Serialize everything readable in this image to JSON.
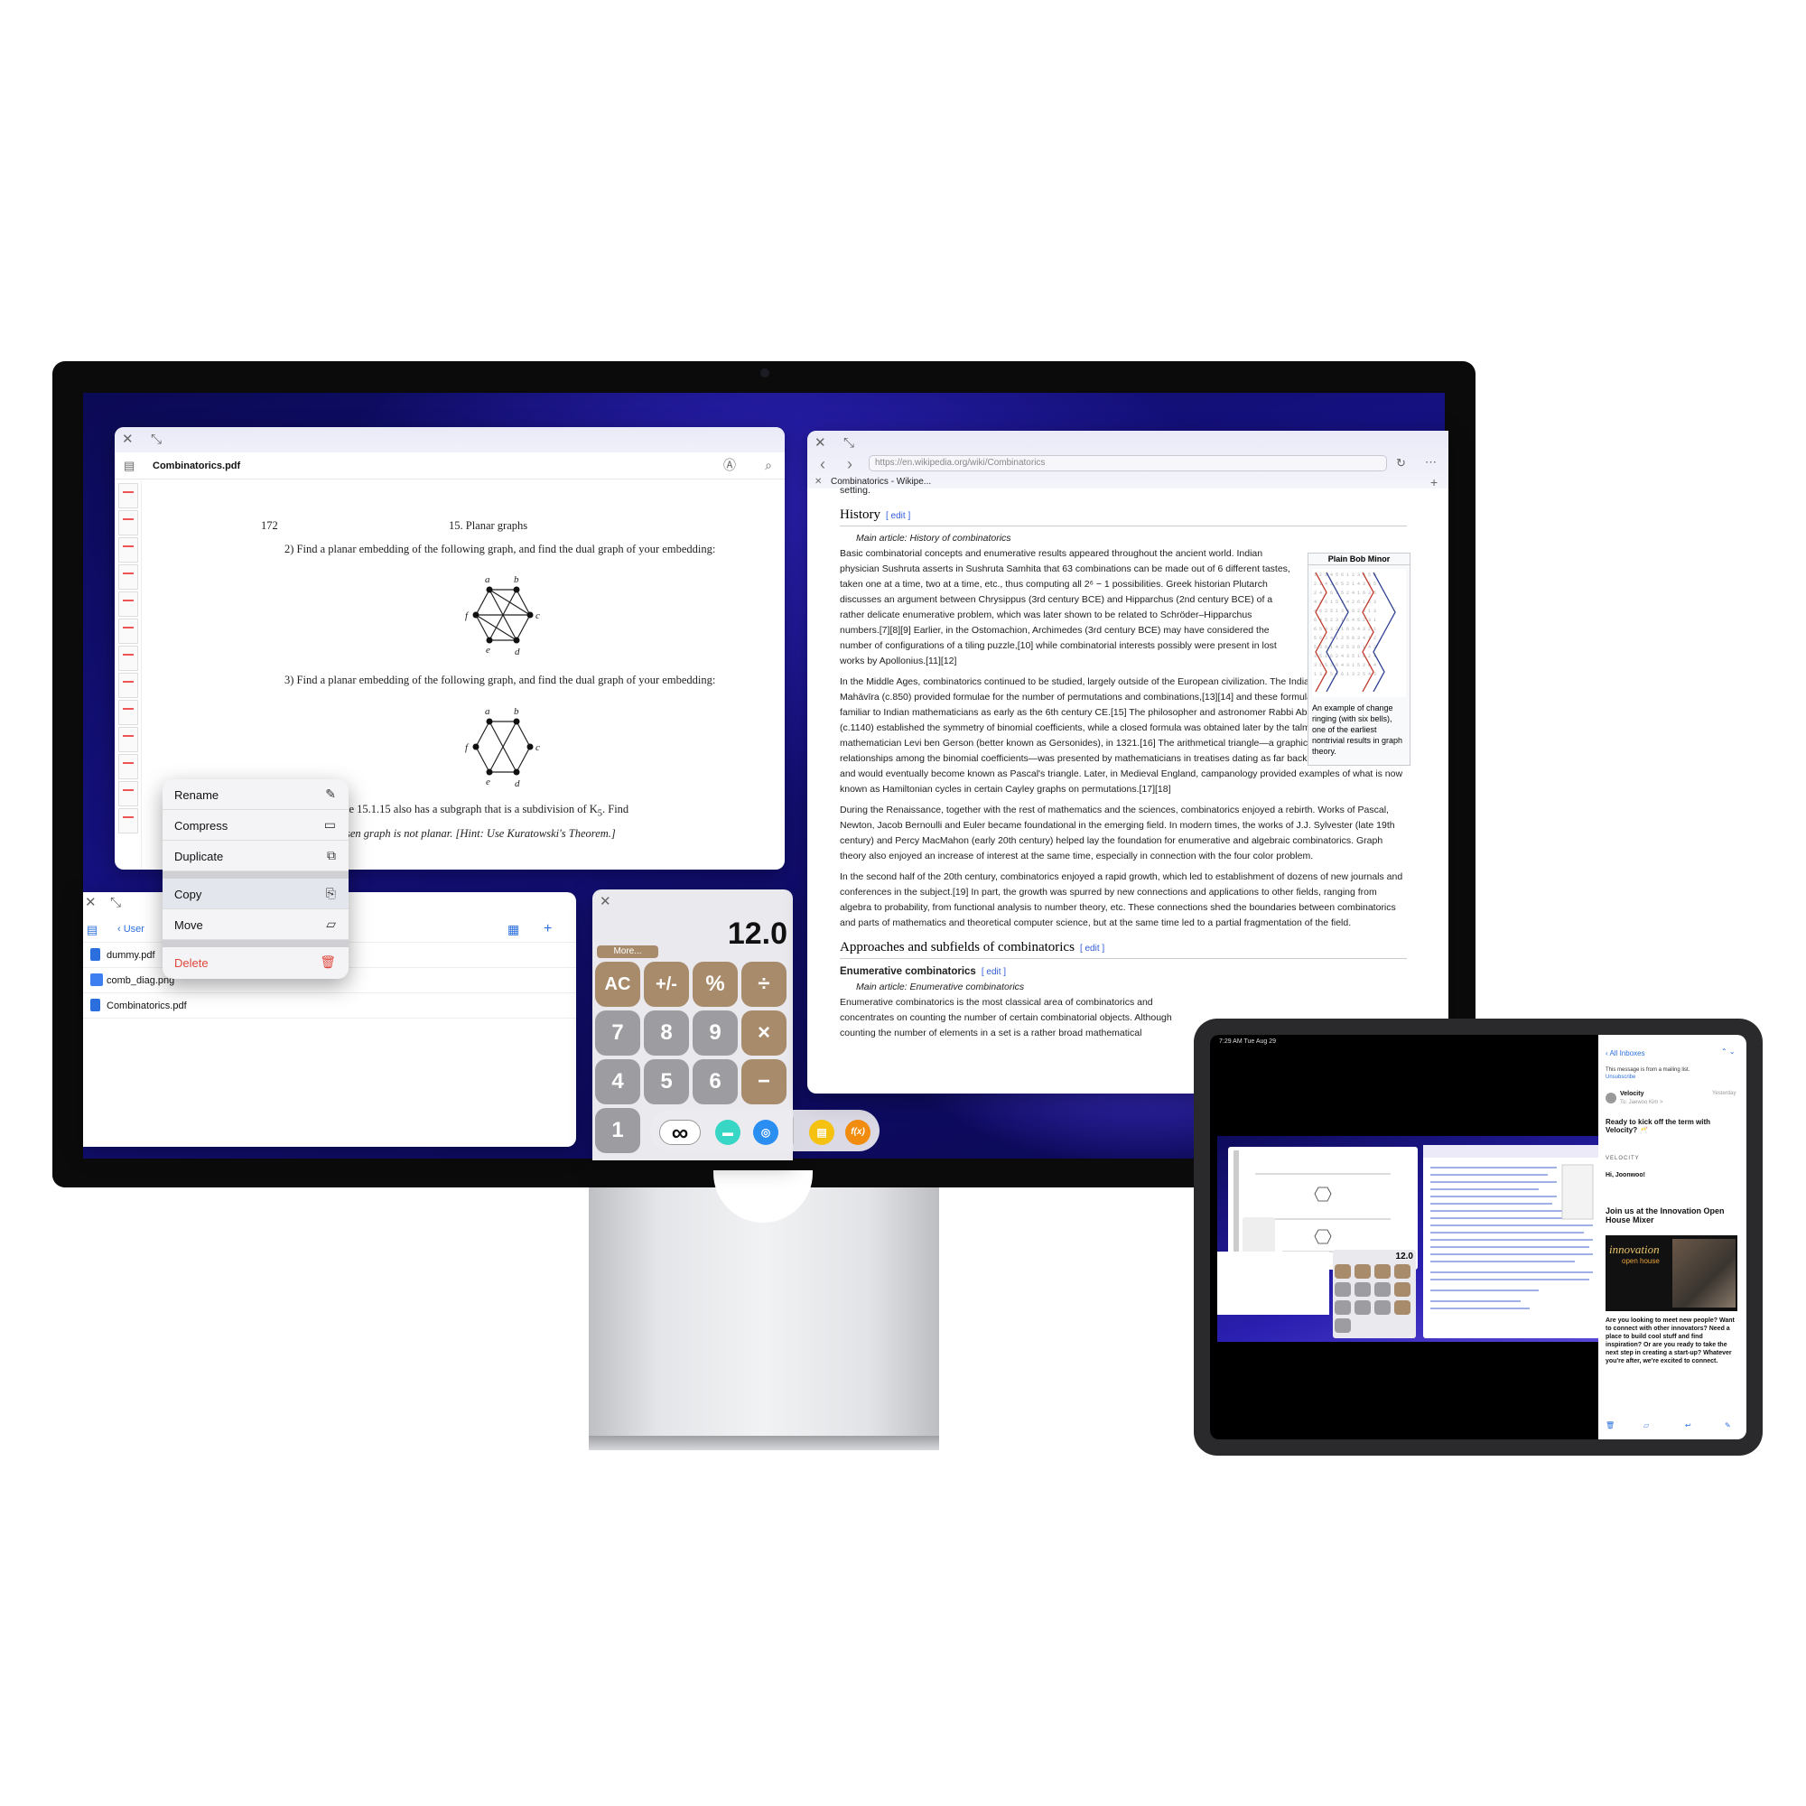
{
  "pdf": {
    "title": "Combinatorics.pdf",
    "page_number": "172",
    "chapter": "15. Planar graphs",
    "q2": "2) Find a planar embedding of the following graph, and find the dual graph of your embedding:",
    "q3": "3) Find a planar embedding of the following graph, and find the dual graph of your embedding:",
    "line_a": "le 15.1.15 also has a subgraph that is a subdivision of K",
    "k_sub": "5",
    "line_a_end": ". Find",
    "line_b": "sen graph is not planar. [Hint: Use Kuratowski's Theorem.]",
    "node_labels": [
      "a",
      "b",
      "c",
      "d",
      "e",
      "f"
    ]
  },
  "context_menu": {
    "items": [
      {
        "label": "Rename",
        "icon": "pencil-icon"
      },
      {
        "label": "Compress",
        "icon": "archive-icon"
      },
      {
        "label": "Duplicate",
        "icon": "duplicate-icon"
      },
      {
        "label": "Copy",
        "icon": "copy-icon"
      },
      {
        "label": "Move",
        "icon": "folder-icon"
      },
      {
        "label": "Delete",
        "icon": "trash-icon"
      }
    ],
    "delete_color": "#e0463c"
  },
  "files": {
    "back_label": "User",
    "items": [
      "dummy.pdf",
      "comb_diag.png",
      "Combinatorics.pdf"
    ]
  },
  "calculator": {
    "display": "12.0",
    "more_label": "More...",
    "keys": [
      "AC",
      "+/-",
      "%",
      "÷",
      "7",
      "8",
      "9",
      "×",
      "4",
      "5",
      "6",
      "−",
      "1"
    ],
    "accent": "#a88b6b"
  },
  "dock": {
    "icons": [
      {
        "name": "infinity-icon",
        "glyph": "∞"
      },
      {
        "name": "files-icon",
        "glyph": ""
      },
      {
        "name": "browser-icon",
        "glyph": ""
      },
      {
        "name": "notes-icon",
        "glyph": ""
      },
      {
        "name": "function-icon",
        "glyph": "f(x)"
      }
    ]
  },
  "wiki": {
    "url": "https://en.wikipedia.org/wiki/Combinatorics",
    "tab_title": "Combinatorics - Wikipe...",
    "top_line": "setting.",
    "history_heading": "History",
    "edit_label": "[ edit ]",
    "history_main": "Main article: History of combinatorics",
    "p1": "Basic combinatorial concepts and enumerative results appeared throughout the ancient world. Indian physician Sushruta asserts in Sushruta Samhita that 63 combinations can be made out of 6 different tastes, taken one at a time, two at a time, etc., thus computing all 2⁶ − 1 possibilities. Greek historian Plutarch discusses an argument between Chrysippus (3rd century BCE) and Hipparchus (2nd century BCE) of a rather delicate enumerative problem, which was later shown to be related to Schröder–Hipparchus numbers.[7][8][9] Earlier, in the Ostomachion, Archimedes (3rd century BCE) may have considered the number of configurations of a tiling puzzle,[10] while combinatorial interests possibly were present in lost works by Apollonius.[11][12]",
    "p2": "In the Middle Ages, combinatorics continued to be studied, largely outside of the European civilization. The Indian mathematician Mahāvīra (c.850) provided formulae for the number of permutations and combinations,[13][14] and these formulas may have been familiar to Indian mathematicians as early as the 6th century CE.[15] The philosopher and astronomer Rabbi Abraham ibn Ezra (c.1140) established the symmetry of binomial coefficients, while a closed formula was obtained later by the talmudist and mathematician Levi ben Gerson (better known as Gersonides), in 1321.[16] The arithmetical triangle—a graphical diagram showing relationships among the binomial coefficients—was presented by mathematicians in treatises dating as far back as the 10th century, and would eventually become known as Pascal's triangle. Later, in Medieval England, campanology provided examples of what is now known as Hamiltonian cycles in certain Cayley graphs on permutations.[17][18]",
    "p3": "During the Renaissance, together with the rest of mathematics and the sciences, combinatorics enjoyed a rebirth. Works of Pascal, Newton, Jacob Bernoulli and Euler became foundational in the emerging field. In modern times, the works of J.J. Sylvester (late 19th century) and Percy MacMahon (early 20th century) helped lay the foundation for enumerative and algebraic combinatorics. Graph theory also enjoyed an increase of interest at the same time, especially in connection with the four color problem.",
    "p4": "In the second half of the 20th century, combinatorics enjoyed a rapid growth, which led to establishment of dozens of new journals and conferences in the subject.[19] In part, the growth was spurred by new connections and applications to other fields, ranging from algebra to probability, from functional analysis to number theory, etc. These connections shed the boundaries between combinatorics and parts of mathematics and theoretical computer science, but at the same time led to a partial fragmentation of the field.",
    "approaches_heading": "Approaches and subfields of combinatorics",
    "enum_heading": "Enumerative combinatorics",
    "enum_edit": "[ edit ]",
    "enum_main": "Main article: Enumerative combinatorics",
    "p5": "Enumerative combinatorics is the most classical area of combinatorics and concentrates on counting the number of certain combinatorial objects. Although counting the number of elements in a set is a rather broad mathematical",
    "figure_title": "Plain Bob Minor",
    "figure_caption": "An example of change ringing (with six bells), one of the earliest nontrivial results in graph theory."
  },
  "ipad": {
    "status_time": "7:29 AM   Tue Aug 29",
    "mail": {
      "back": "All Inboxes",
      "mailing_note": "This message is from a mailing list.",
      "unsubscribe": "Unsubscribe",
      "sender": "Velocity",
      "date": "Yesterday",
      "to": "To: Jaewoo Kim >",
      "subject": "Ready to kick off the term with Velocity? 🥂",
      "brand": "VELOCITY",
      "greeting": "Hi, Joonwoo!",
      "headline": "Join us at the Innovation Open House Mixer",
      "banner_title": "innovation",
      "banner_sub": "open house",
      "body": "Are you looking to meet new people? Want to connect with other innovators? Need a place to build cool stuff and find inspiration? Or are you ready to take the next step in creating a start-up? Whatever you're after, we're excited to connect."
    },
    "mini_calc_display": "12.0"
  }
}
